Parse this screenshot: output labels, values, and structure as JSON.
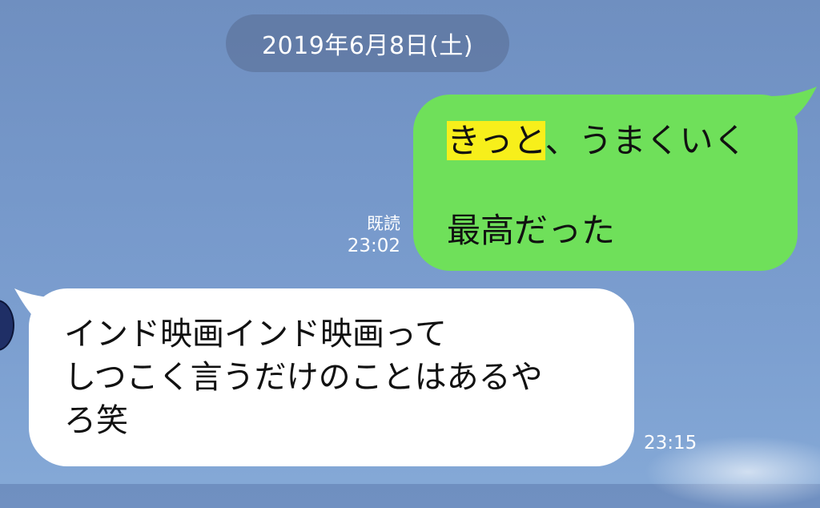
{
  "chat": {
    "date_separator": "2019年6月8日(土)"
  },
  "messages": {
    "sent": {
      "highlighted_text": "きっと",
      "line1_rest": "、うまくいく",
      "line2": "最高だった",
      "read_label": "既読",
      "time": "23:02",
      "bubble_color": "#6fe05a",
      "highlight_color": "#f7ef1b"
    },
    "received": {
      "line1": "インド映画インド映画って",
      "line2": "しつこく言うだけのことはあるや",
      "line3": "ろ笑",
      "time": "23:15",
      "bubble_color": "#ffffff"
    }
  },
  "icons": {
    "avatar": "avatar-icon"
  }
}
